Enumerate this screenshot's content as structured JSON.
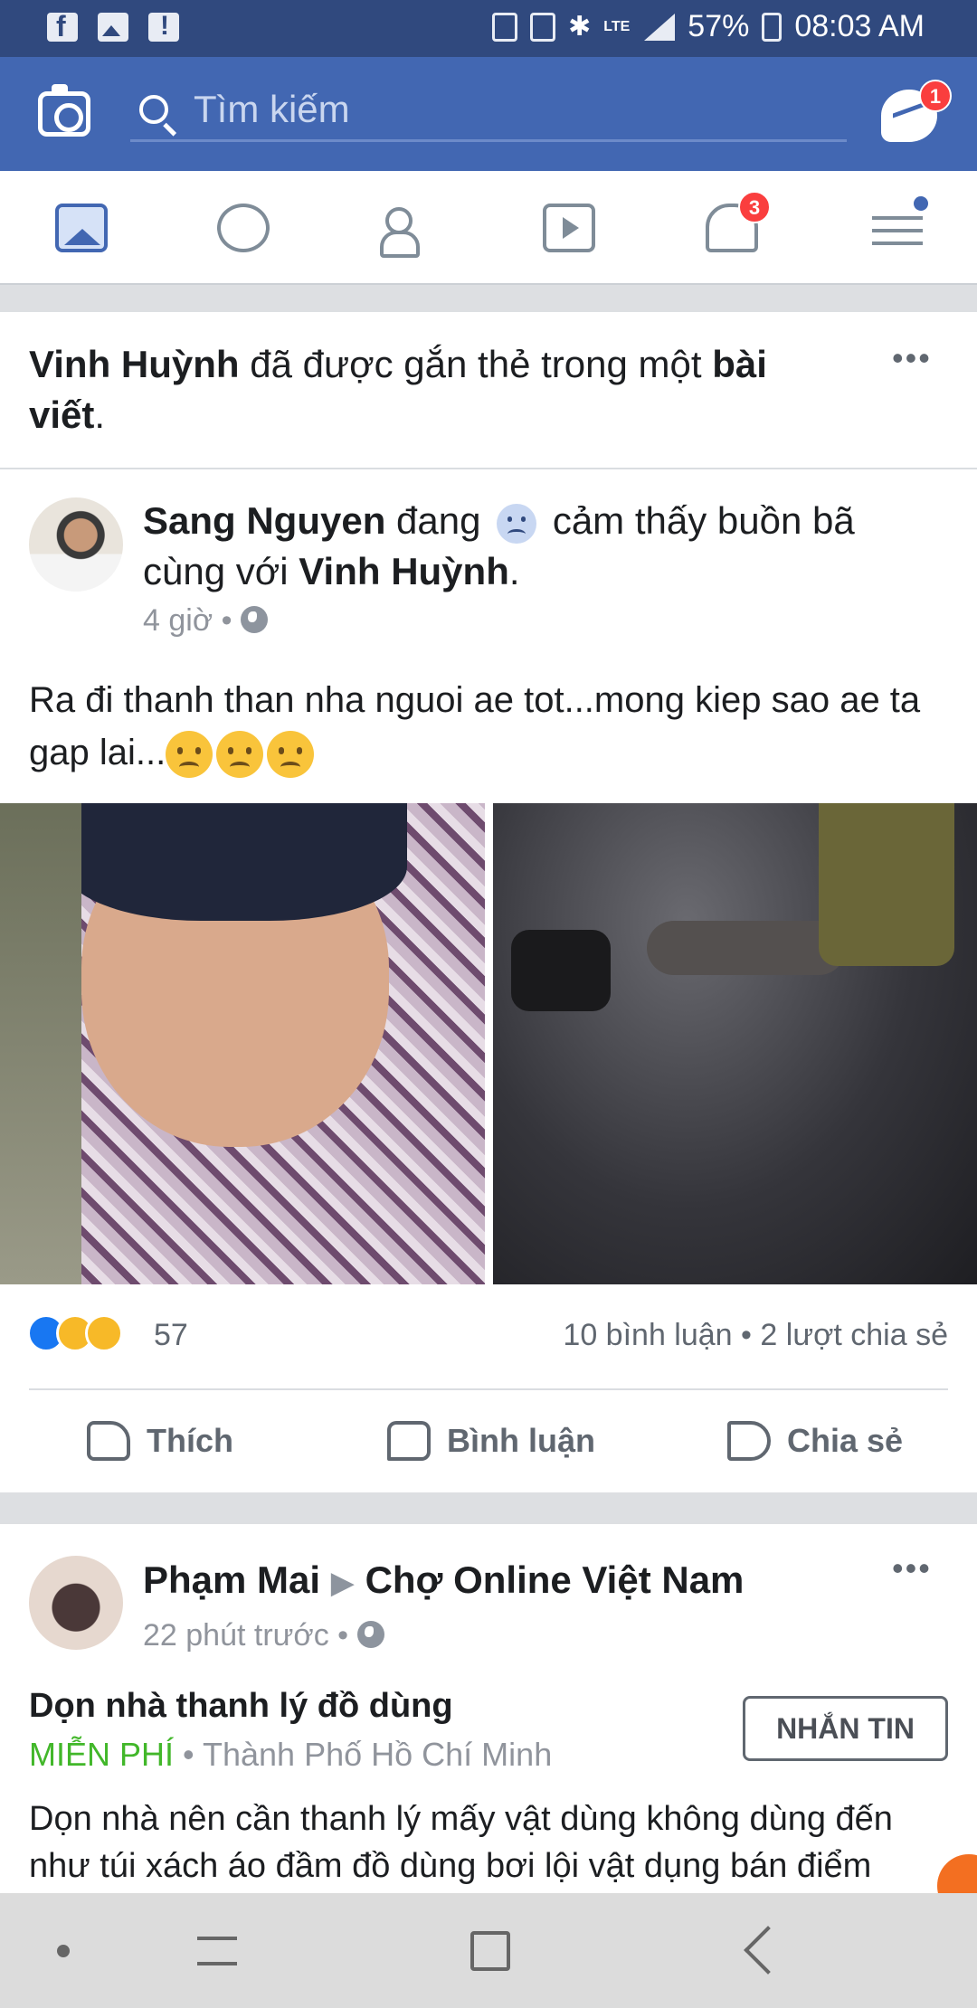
{
  "status_bar": {
    "battery": "57%",
    "time": "08:03 AM",
    "network": "LTE"
  },
  "top_bar": {
    "search_placeholder": "Tìm kiếm",
    "messenger_badge": "1"
  },
  "tab_bar": {
    "notifications_badge": "3"
  },
  "card1": {
    "tag_name": "Vinh Huỳnh",
    "tag_mid": " đã được gắn thẻ trong một ",
    "tag_bold": "bài viết",
    "tag_end": ".",
    "author": "Sang Nguyen",
    "feeling_pre": " đang ",
    "feeling": " cảm thấy buồn bã cùng với ",
    "with": "Vinh Huỳnh",
    "with_end": ".",
    "time": "4 giờ",
    "sep": "•",
    "text": "Ra đi thanh than nha nguoi ae tot...mong kiep sao ae ta gap lai...",
    "reaction_count": "57",
    "comments": "10 bình luận",
    "shares": "2 lượt chia sẻ",
    "like_label": "Thích",
    "comment_label": "Bình luận",
    "share_label": "Chia sẻ"
  },
  "card2": {
    "author": "Phạm Mai",
    "group": "Chợ Online Việt Nam",
    "time": "22 phút trước",
    "sep": "•",
    "listing_title": "Dọn nhà thanh lý đồ dùng",
    "price": "MIỄN PHÍ",
    "location": "Thành Phố Hồ Chí Minh",
    "message_button": "NHẮN TIN",
    "text_line1": "Dọn nhà nên cần thanh lý mấy vật dùng không dùng đến",
    "text_line2": "như túi xách áo đầm đồ dùng bơi lội vật dụng bán điểm"
  },
  "colors": {
    "brand": "#4267b2",
    "status_bar": "#30497e",
    "price_green": "#42b72a",
    "badge_red": "#fa3e3e"
  },
  "icons": [
    "facebook-icon",
    "photo-icon",
    "alert-icon",
    "camera-icon",
    "search-icon",
    "messenger-icon",
    "news-feed-icon",
    "groups-icon",
    "friends-icon",
    "watch-icon",
    "notifications-icon",
    "menu-icon",
    "globe-icon",
    "like-icon",
    "comment-icon",
    "share-icon",
    "more-icon"
  ]
}
